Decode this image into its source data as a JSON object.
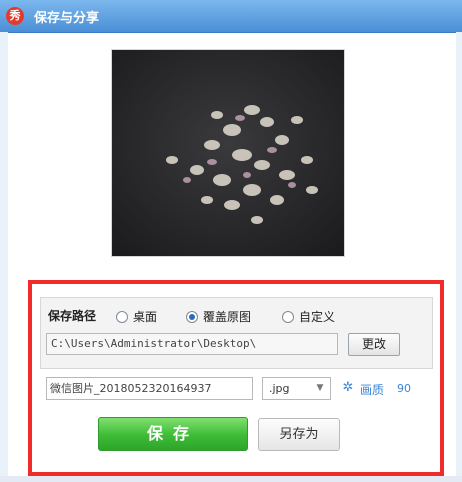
{
  "window": {
    "title": "保存与分享",
    "app_icon_glyph": "秀"
  },
  "preview": {
    "icon": "photo-preview-image"
  },
  "save_path": {
    "label": "保存路径",
    "options": [
      "桌面",
      "覆盖原图",
      "自定义"
    ],
    "selected": "覆盖原图",
    "path_value": "C:\\Users\\Administrator\\Desktop\\",
    "change_button": "更改"
  },
  "file": {
    "name_value": "微信图片_20180523201649​37",
    "extension": ".jpg",
    "quality_label": "画质",
    "quality_value": "90"
  },
  "actions": {
    "save_label": "保存",
    "save_as_label": "另存为"
  },
  "colors": {
    "titlebar": "#4a8fd6",
    "highlight": "#f12a2a",
    "save_button": "#3dbb36",
    "link": "#3b86d8"
  }
}
